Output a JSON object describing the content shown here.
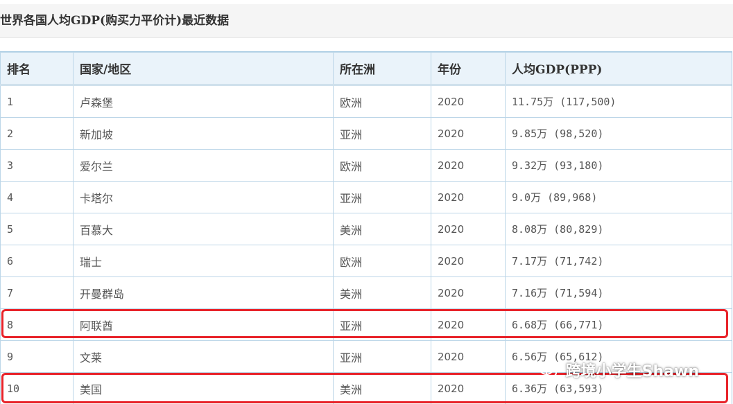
{
  "header": {
    "title": "世界各国人均GDP(购买力平价计)最近数据"
  },
  "table": {
    "columns": [
      "排名",
      "国家/地区",
      "所在洲",
      "年份",
      "人均GDP(PPP)"
    ],
    "rows": [
      [
        "1",
        "卢森堡",
        "欧洲",
        "2020",
        "11.75万 (117,500)"
      ],
      [
        "2",
        "新加坡",
        "亚洲",
        "2020",
        "9.85万 (98,520)"
      ],
      [
        "3",
        "爱尔兰",
        "欧洲",
        "2020",
        "9.32万 (93,180)"
      ],
      [
        "4",
        "卡塔尔",
        "亚洲",
        "2020",
        "9.0万 (89,968)"
      ],
      [
        "5",
        "百慕大",
        "美洲",
        "2020",
        "8.08万 (80,829)"
      ],
      [
        "6",
        "瑞士",
        "欧洲",
        "2020",
        "7.17万 (71,742)"
      ],
      [
        "7",
        "开曼群岛",
        "美洲",
        "2020",
        "7.16万 (71,594)"
      ],
      [
        "8",
        "阿联酋",
        "亚洲",
        "2020",
        "6.68万 (66,771)"
      ],
      [
        "9",
        "文莱",
        "亚洲",
        "2020",
        "6.56万 (65,612)"
      ],
      [
        "10",
        "美国",
        "美洲",
        "2020",
        "6.36万 (63,593)"
      ]
    ],
    "highlighted_ranks": [
      "8",
      "10"
    ]
  },
  "watermark": {
    "text": "跨境小学生Shawn",
    "icon": "wechat-icon"
  },
  "colors": {
    "header_bg": "#eaf3fa",
    "border": "#bcd6e8",
    "highlight": "#e8232a"
  }
}
